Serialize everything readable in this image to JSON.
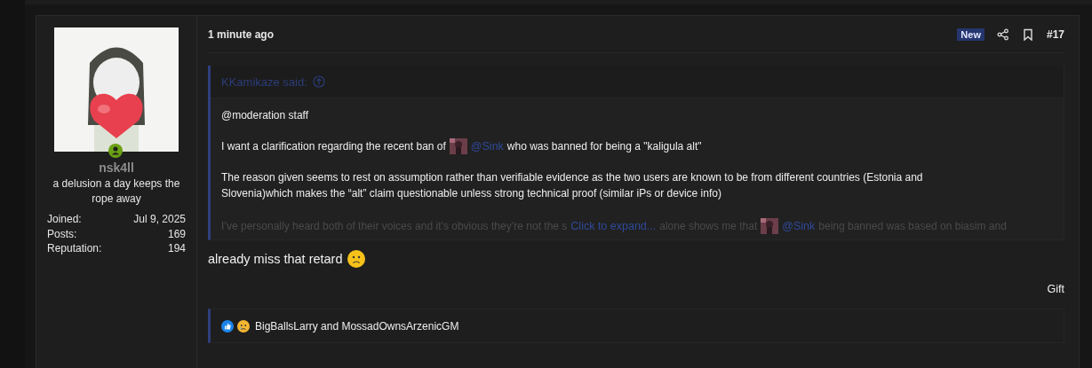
{
  "post": {
    "author": {
      "name": "nsk4ll",
      "online": true,
      "title": "a delusion a day keeps the rope away",
      "stats": [
        {
          "label": "Joined:",
          "value": "Jul 9, 2025"
        },
        {
          "label": "Posts:",
          "value": "169"
        },
        {
          "label": "Reputation:",
          "value": "194"
        }
      ]
    },
    "time": "1 minute ago",
    "badge": "New",
    "number": "#17",
    "quote": {
      "author": "KKamikaze said:",
      "paragraphs": [
        [
          {
            "kind": "text",
            "text": "@moderation staff"
          }
        ],
        [
          {
            "kind": "text",
            "text": "I want a clarification regarding the recent ban of"
          },
          {
            "kind": "mention",
            "text": "@Sink"
          },
          {
            "kind": "text",
            "text": "who was banned for being a \"kaligula alt\""
          }
        ],
        [
          {
            "kind": "text",
            "text": "The reason given seems to rest on assumption rather than verifiable evidence as the two users are known to be from different countries (Estonia and Slovenia)which makes the “alt” claim questionable unless strong technical proof (similar iPs or device info)"
          }
        ]
      ],
      "faded": [
        {
          "kind": "text",
          "text": "I’ve personally heard both of their voices and it’s obvious they’re not the s"
        },
        {
          "kind": "expand",
          "text": "Click to expand..."
        },
        {
          "kind": "text",
          "text": "alone shows me that"
        },
        {
          "kind": "mention",
          "text": "@Sink"
        },
        {
          "kind": "text",
          "text": "being banned was based on biasim and"
        }
      ]
    },
    "message": "already miss that retard",
    "gift": "Gift",
    "reactions": {
      "users": "BigBallsLarry and MossadOwnsArzenicGM"
    }
  }
}
